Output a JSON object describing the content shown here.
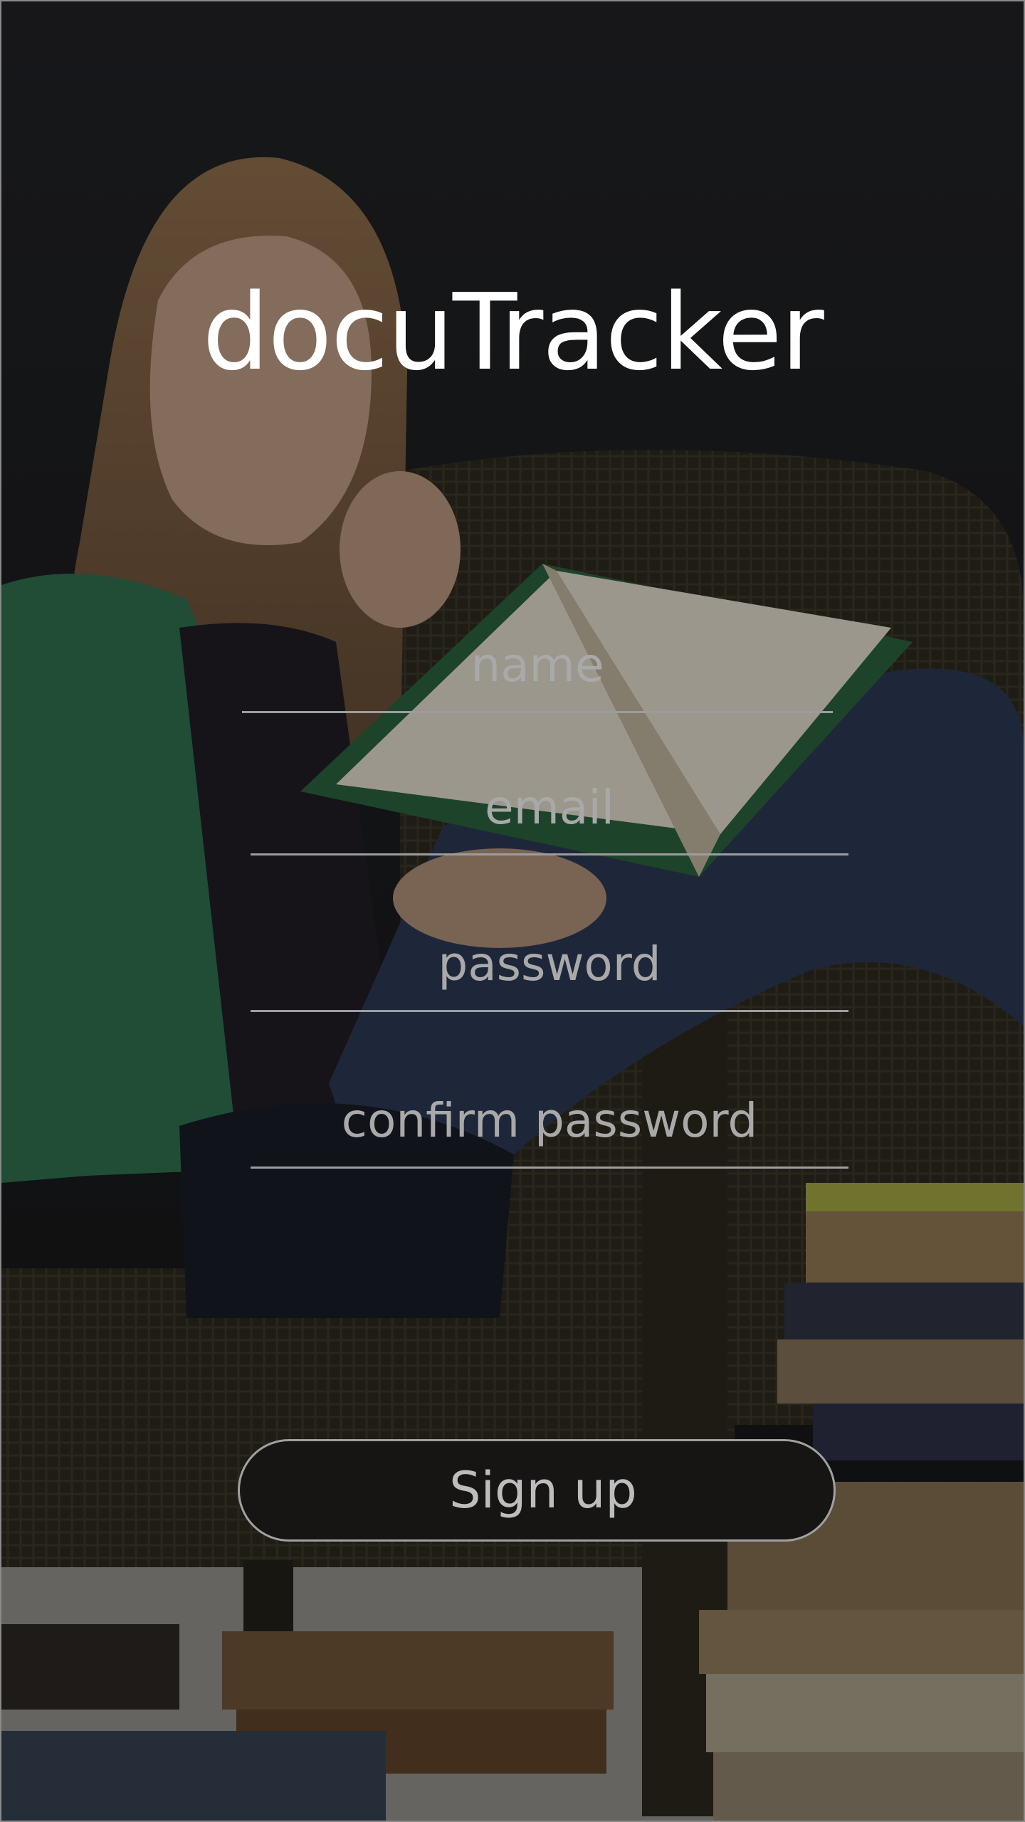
{
  "app": {
    "title": "docuTracker"
  },
  "form": {
    "name_placeholder": "name",
    "email_placeholder": "email",
    "password_placeholder": "password",
    "confirm_password_placeholder": "confirm password",
    "signup_label": "Sign up"
  },
  "colors": {
    "title_text": "#ffffff",
    "placeholder_text": "#a9a9a9",
    "underline": "#9d9d9d",
    "button_background": "#161514",
    "button_border": "#a0a0a0",
    "button_text": "#bdbdbd"
  }
}
